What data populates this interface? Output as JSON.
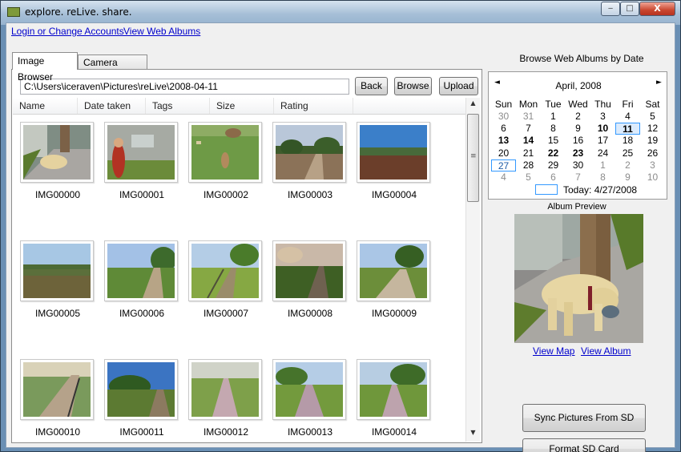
{
  "window": {
    "title": "explore. reLive. share.",
    "minimize_glyph": "‒",
    "maximize_glyph": "□",
    "close_glyph": "X"
  },
  "links": {
    "login": "Login or Change Accounts",
    "view_albums": "View Web Albums"
  },
  "tabs": [
    {
      "label": "Image Browser",
      "selected": true
    },
    {
      "label": "Camera Settings",
      "selected": false
    }
  ],
  "path": {
    "value": "C:\\Users\\iceraven\\Pictures\\reLive\\2008-04-11"
  },
  "toolbar": {
    "back": "Back",
    "browse": "Browse",
    "upload": "Upload"
  },
  "columns": [
    "Name",
    "Date taken",
    "Tags",
    "Size",
    "Rating"
  ],
  "images": [
    {
      "name": "IMG00000"
    },
    {
      "name": "IMG00001"
    },
    {
      "name": "IMG00002"
    },
    {
      "name": "IMG00003"
    },
    {
      "name": "IMG00004"
    },
    {
      "name": "IMG00005"
    },
    {
      "name": "IMG00006"
    },
    {
      "name": "IMG00007"
    },
    {
      "name": "IMG00008"
    },
    {
      "name": "IMG00009"
    },
    {
      "name": "IMG00010"
    },
    {
      "name": "IMG00011"
    },
    {
      "name": "IMG00012"
    },
    {
      "name": "IMG00013"
    },
    {
      "name": "IMG00014"
    }
  ],
  "calendar": {
    "title": "Browse Web Albums by Date",
    "month": "April, 2008",
    "prev_glyph": "◄",
    "next_glyph": "►",
    "day_headers": [
      "Sun",
      "Mon",
      "Tue",
      "Wed",
      "Thu",
      "Fri",
      "Sat"
    ],
    "weeks": [
      [
        "30",
        "31",
        "1",
        "2",
        "3",
        "4",
        "5"
      ],
      [
        "6",
        "7",
        "8",
        "9",
        "10",
        "11",
        "12"
      ],
      [
        "13",
        "14",
        "15",
        "16",
        "17",
        "18",
        "19"
      ],
      [
        "20",
        "21",
        "22",
        "23",
        "24",
        "25",
        "26"
      ],
      [
        "27",
        "28",
        "29",
        "30",
        "1",
        "2",
        "3"
      ],
      [
        "4",
        "5",
        "6",
        "7",
        "8",
        "9",
        "10"
      ]
    ],
    "bold_days": [
      "10",
      "11",
      "13",
      "14",
      "22",
      "23"
    ],
    "selected_day": "11",
    "today_day": "27",
    "today_label": "Today: 4/27/2008"
  },
  "preview": {
    "label": "Album Preview",
    "view_map": "View Map",
    "view_album": "View Album"
  },
  "buttons": {
    "sync": "Sync Pictures From SD Card",
    "format": "Format SD Card"
  },
  "scrollbar": {
    "up_glyph": "▲",
    "down_glyph": "▼",
    "grip_glyph": "≡"
  }
}
